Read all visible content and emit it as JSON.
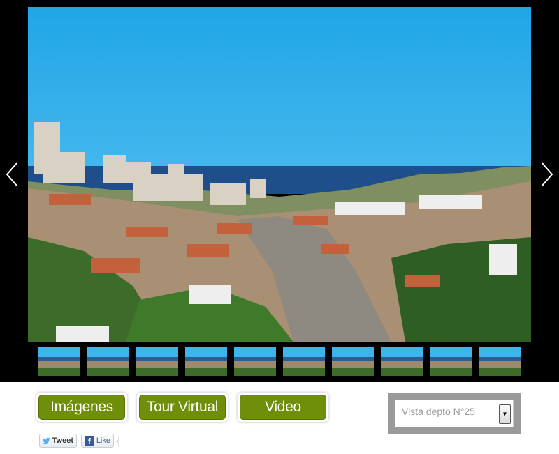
{
  "gallery": {
    "main_image": "coastal-city-view-photo",
    "thumbnail_count": 10,
    "prev_icon": "chevron-left-icon",
    "next_icon": "chevron-right-icon"
  },
  "nav_buttons": [
    {
      "label": "Imágenes"
    },
    {
      "label": "Tour Virtual"
    },
    {
      "label": "Video"
    }
  ],
  "select": {
    "selected": "Vista depto N°25",
    "arrow_icon": "triangle-down-icon"
  },
  "social": {
    "tweet_label": "Tweet",
    "like_label": "Like",
    "tweet_icon": "twitter-bird-icon",
    "like_icon": "facebook-f-icon"
  },
  "colors": {
    "button_green": "#6f8f0a",
    "gallery_bg": "#000000",
    "select_panel": "#9a9a9a"
  }
}
